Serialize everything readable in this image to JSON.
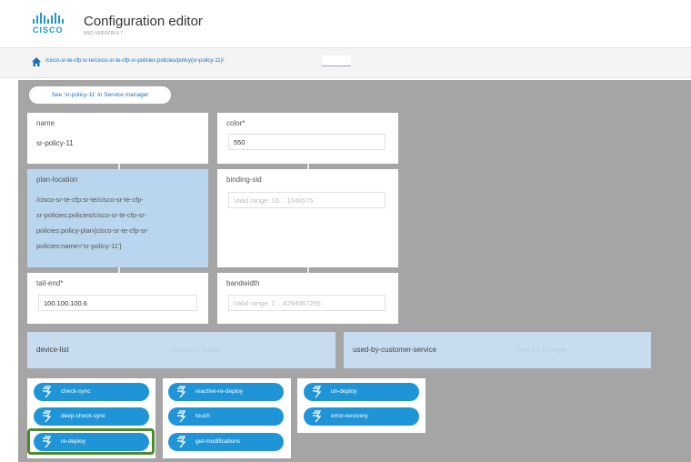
{
  "header": {
    "logo_text": "CISCO",
    "title": "Configuration editor",
    "version": "NSO VERSION 4.7"
  },
  "breadcrumb": {
    "path": "/cisco-sr-te-cfp:sr-te/cisco-sr-te-cfp-sr-policies:policies/policy{sr-policy-11}/",
    "input_value": ""
  },
  "service_link": "See 'sr-policy-11' in Service manager",
  "fields": {
    "name": {
      "label": "name",
      "value": "sr-policy-11"
    },
    "color": {
      "label": "color*",
      "value": "550"
    },
    "plan_location": {
      "label": "plan-location",
      "lines": [
        "/cisco-sr-te-cfp:sr-te/cisco-sr-te-cfp-",
        "sr-policies:policies/cisco-sr-te-cfp-sr-",
        "policies:policy-plan{cisco-sr-te-cfp-sr-",
        "policies:name='sr-policy-11'}"
      ]
    },
    "binding_sid": {
      "label": "binding-sid",
      "placeholder": "Valid range: 16 .. 1048575"
    },
    "tail_end": {
      "label": "tail-end*",
      "value": "100.100.100.6"
    },
    "bandwidth": {
      "label": "bandwidth",
      "placeholder": "Valid range: 1 .. 4294967295"
    }
  },
  "lists": {
    "device_list": {
      "label": "device-list",
      "empty": "This list is empty"
    },
    "used_by": {
      "label": "used-by-customer-service",
      "empty": "This list is empty"
    }
  },
  "actions": {
    "group1": [
      "check-sync",
      "deep-check-sync",
      "re-deploy"
    ],
    "group2": [
      "reactive-re-deploy",
      "touch",
      "get-modifications"
    ],
    "group3": [
      "un-deploy",
      "error-recovery"
    ]
  },
  "colors": {
    "accent": "#1f95d7",
    "highlight": "#4d8a2e",
    "panel": "#a5a5a5",
    "selected": "#b9d6ee"
  }
}
